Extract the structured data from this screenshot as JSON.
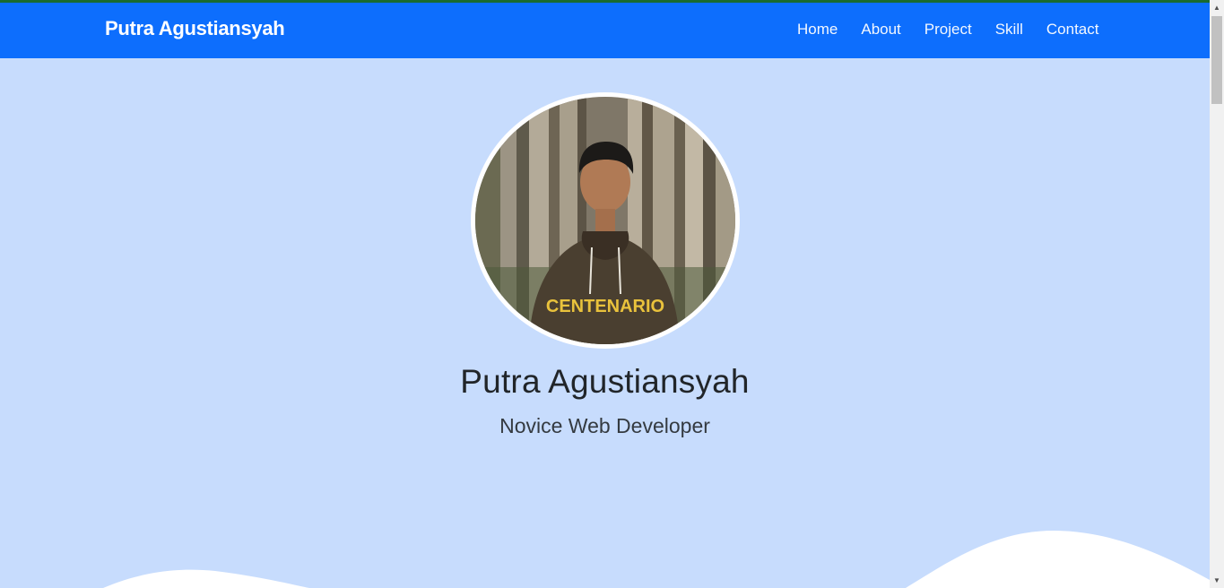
{
  "navbar": {
    "brand": "Putra Agustiansyah",
    "links": [
      "Home",
      "About",
      "Project",
      "Skill",
      "Contact"
    ]
  },
  "hero": {
    "name": "Putra Agustiansyah",
    "role": "Novice Web Developer",
    "photo_shirt_text": "CENTENARIO"
  },
  "colors": {
    "navbar_bg": "#0d6efd",
    "hero_bg": "#c7dcfd",
    "wave": "#ffffff"
  },
  "scrollbar": {
    "up_icon": "arrow-up-icon",
    "down_icon": "arrow-down-icon"
  }
}
